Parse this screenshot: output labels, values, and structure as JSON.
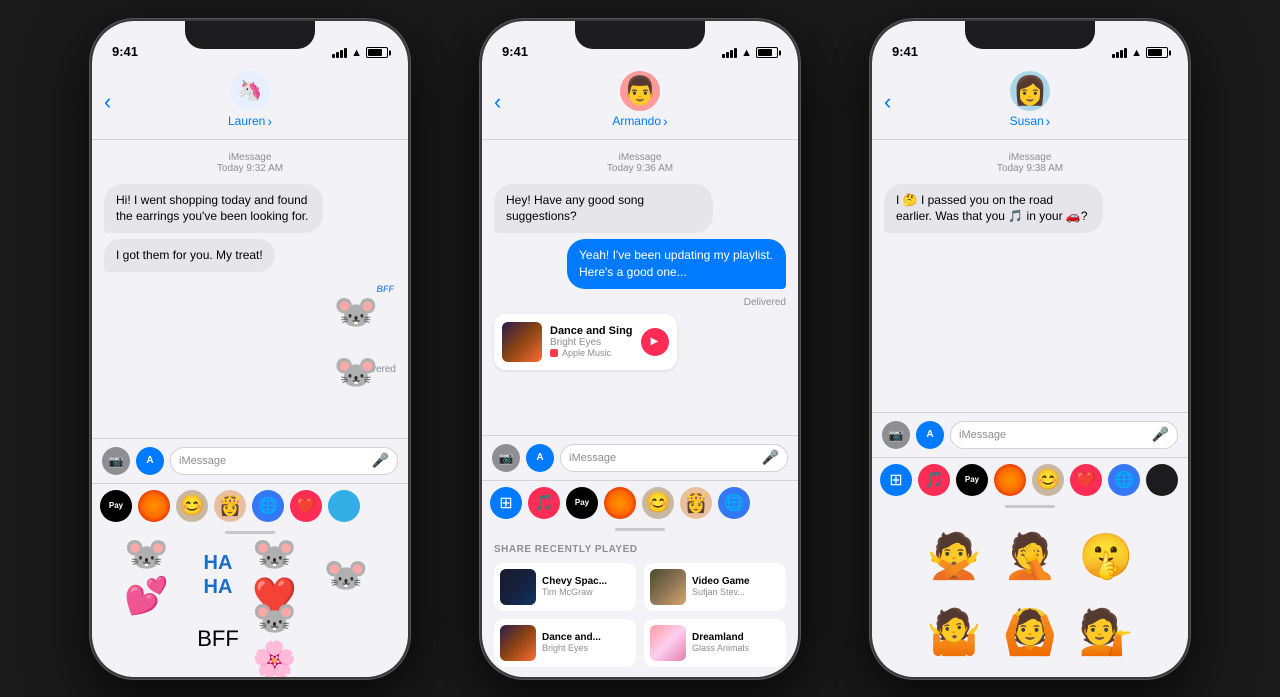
{
  "background": "#1a1a1a",
  "phones": [
    {
      "id": "phone1",
      "contact": {
        "name": "Lauren",
        "avatar": "🦄",
        "avatar_bg": "#e8f0ff"
      },
      "status_time": "9:41",
      "messages": [
        {
          "type": "timestamp",
          "text": "iMessage\nToday 9:32 AM"
        },
        {
          "type": "received",
          "text": "Hi! I went shopping today and found the earrings you've been looking for."
        },
        {
          "type": "received",
          "text": "I got them for you. My treat!"
        },
        {
          "type": "sticker",
          "emoji": "🐭💑"
        }
      ],
      "delivered": "Delivered",
      "input_placeholder": "iMessage",
      "panel": "stickers",
      "app_icons": [
        "apple-pay",
        "rainbow-circle",
        "stickers1",
        "stickers2",
        "globe",
        "heart",
        "blue-circle"
      ]
    },
    {
      "id": "phone2",
      "contact": {
        "name": "Armando",
        "avatar": "👨",
        "avatar_bg": "#ff6b6b"
      },
      "status_time": "9:41",
      "messages": [
        {
          "type": "timestamp",
          "text": "iMessage\nToday 9:36 AM"
        },
        {
          "type": "received",
          "text": "Hey! Have any good song suggestions?"
        },
        {
          "type": "sent",
          "text": "Yeah! I've been updating my playlist. Here's a good one..."
        },
        {
          "type": "delivered",
          "text": "Delivered"
        },
        {
          "type": "music",
          "title": "Dance and Sing",
          "artist": "Bright Eyes",
          "source": "Apple Music"
        }
      ],
      "input_placeholder": "iMessage",
      "panel": "share",
      "share_title": "SHARE RECENTLY PLAYED",
      "share_items": [
        {
          "title": "Chevy Spac...",
          "subtitle": "Tim McGraw",
          "bg": "linear-gradient(135deg, #1a1a2e, #16213e, #0f3460)"
        },
        {
          "title": "Video Game",
          "subtitle": "Sufjan Stev...",
          "bg": "linear-gradient(135deg, #4a4a2a, #8b7355, #d4a76a)"
        },
        {
          "title": "Dance and...",
          "subtitle": "Bright Eyes",
          "bg": "linear-gradient(135deg, #2d1b4e, #8b4513, #ff6b35)"
        },
        {
          "title": "Dreamland",
          "subtitle": "Glass Animals",
          "bg": "linear-gradient(135deg, #ff9a9e, #fecfef, #ffecd2)"
        }
      ],
      "app_icons": [
        "apps-blue",
        "music-pink",
        "apple-pay",
        "rainbow-circle",
        "stickers1",
        "stickers2",
        "globe"
      ]
    },
    {
      "id": "phone3",
      "contact": {
        "name": "Susan",
        "avatar": "👩",
        "avatar_bg": "#a8d8ea"
      },
      "status_time": "9:41",
      "messages": [
        {
          "type": "timestamp",
          "text": "iMessage\nToday 9:38 AM"
        },
        {
          "type": "received",
          "text": "I 🤔 I passed you on the road earlier. Was that you 🎵 in your 🚗?"
        }
      ],
      "input_placeholder": "iMessage",
      "panel": "memoji",
      "app_icons": [
        "apps-blue",
        "music-pink",
        "apple-pay",
        "rainbow-circle",
        "stickers1",
        "heart-sticker",
        "globe",
        "dark-circle"
      ]
    }
  ]
}
